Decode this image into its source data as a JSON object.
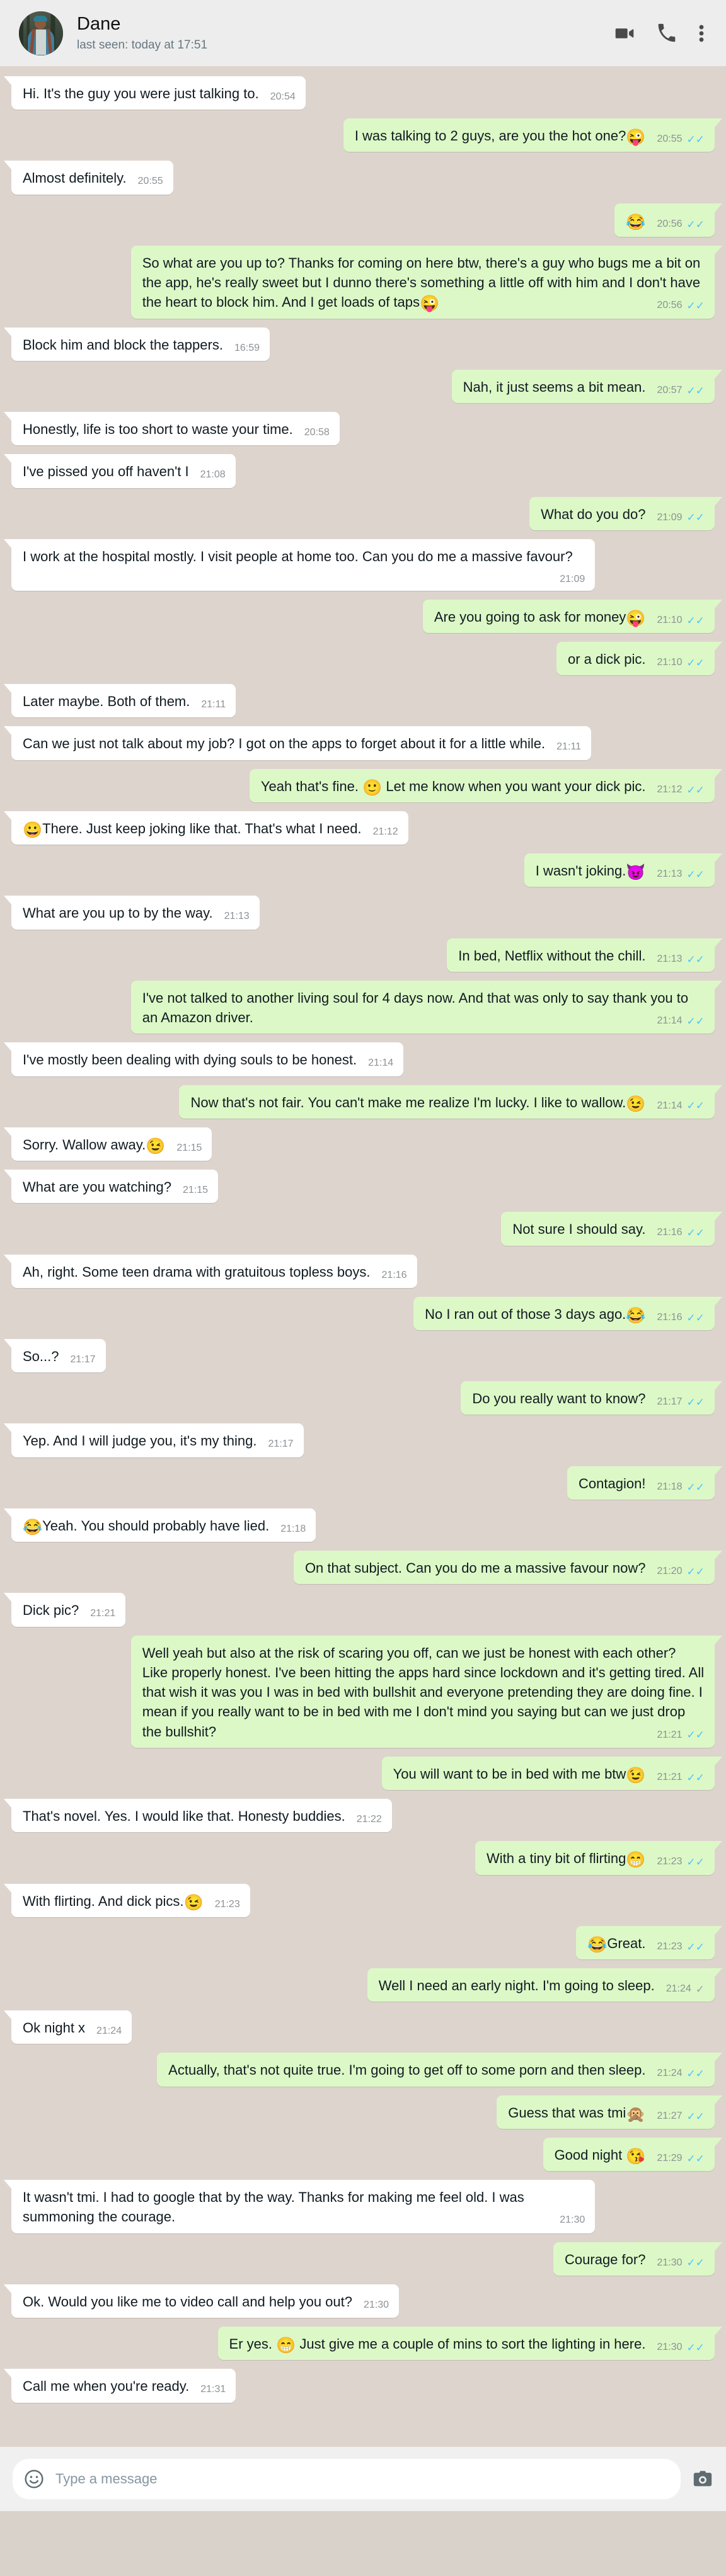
{
  "header": {
    "contact_name": "Dane",
    "status": "last seen: today at 17:51",
    "avatar_name": "contact-avatar",
    "icons": {
      "video_call": "video-camera-icon",
      "voice_call": "phone-icon",
      "menu": "overflow-menu-icon"
    }
  },
  "composer": {
    "placeholder": "Type a message",
    "value": "",
    "emoji_icon": "smiley-face-icon",
    "camera_icon": "camera-icon"
  },
  "colors": {
    "incoming_bubble": "#ffffff",
    "outgoing_bubble": "#dcf8c6",
    "chat_background": "#ded4ce",
    "header_background": "#ededed",
    "read_tick": "#4fc3f7",
    "delivered_tick": "#9aa4a8",
    "timestamp": "#8c9296"
  },
  "messages": [
    {
      "side": "in",
      "text": "Hi. It's the guy you were just talking to.",
      "time": "20:54",
      "status": "none"
    },
    {
      "side": "out",
      "text": "I was talking to 2 guys, are you the hot one?",
      "emoji_after": "😜",
      "time": "20:55",
      "status": "read"
    },
    {
      "side": "in",
      "text": "Almost definitely.",
      "time": "20:55",
      "status": "none"
    },
    {
      "side": "out",
      "text": "",
      "emoji_after": "😂",
      "time": "20:56",
      "status": "read"
    },
    {
      "side": "out",
      "text": "So what are you up to? Thanks for coming on here btw, there's a guy who bugs me a bit on the app, he's really sweet but I dunno there's something a little off with him and I don't have the heart to block him. And I get loads of taps",
      "emoji_after": "😜",
      "time": "20:56",
      "status": "read"
    },
    {
      "side": "in",
      "text": "Block him and block the tappers.",
      "time": "16:59",
      "status": "none"
    },
    {
      "side": "out",
      "text": "Nah, it just seems a bit mean.",
      "time": "20:57",
      "status": "read"
    },
    {
      "side": "in",
      "text": "Honestly, life is too short to waste your time.",
      "time": "20:58",
      "status": "none"
    },
    {
      "side": "in",
      "text": "I've pissed you off haven't I",
      "time": "21:08",
      "status": "none"
    },
    {
      "side": "out",
      "text": "What do you do?",
      "time": "21:09",
      "status": "read"
    },
    {
      "side": "in",
      "text": "I work at the hospital mostly. I visit people at home too. Can you do me a massive favour?",
      "time": "21:09",
      "status": "none"
    },
    {
      "side": "out",
      "text": "Are you going to ask for money",
      "emoji_after": "😜",
      "time": "21:10",
      "status": "read"
    },
    {
      "side": "out",
      "text": "or a dick pic.",
      "time": "21:10",
      "status": "read"
    },
    {
      "side": "in",
      "text": "Later maybe. Both of them.",
      "time": "21:11",
      "status": "none"
    },
    {
      "side": "in",
      "text": "Can we just not talk about my job? I got on the apps to forget about it for a little while.",
      "time": "21:11",
      "status": "none"
    },
    {
      "side": "out",
      "text": "Yeah that's fine. ",
      "emoji_mid": "🙂",
      "text2": " Let me know when you want your dick pic.",
      "time": "21:12",
      "status": "read"
    },
    {
      "side": "in",
      "emoji_before": "😀",
      "text": "There. Just keep joking like that. That's what I need.",
      "time": "21:12",
      "status": "none"
    },
    {
      "side": "out",
      "text": "I wasn't joking.",
      "emoji_after": "😈",
      "time": "21:13",
      "status": "read"
    },
    {
      "side": "in",
      "text": "What are you up to by the way.",
      "time": "21:13",
      "status": "none"
    },
    {
      "side": "out",
      "text": "In bed, Netflix without the chill.",
      "time": "21:13",
      "status": "read"
    },
    {
      "side": "out",
      "text": "I've not talked to another living soul for 4 days now. And that was only to say thank you to an Amazon driver.",
      "time": "21:14",
      "status": "read"
    },
    {
      "side": "in",
      "text": "I've mostly been dealing with dying souls to be honest.",
      "time": "21:14",
      "status": "none"
    },
    {
      "side": "out",
      "text": "Now that's not fair. You can't make me realize I'm lucky. I like to wallow.",
      "emoji_after": "😉",
      "time": "21:14",
      "status": "read"
    },
    {
      "side": "in",
      "text": "Sorry. Wallow away.",
      "emoji_after": "😉",
      "time": "21:15",
      "status": "none"
    },
    {
      "side": "in",
      "text": "What are you watching?",
      "time": "21:15",
      "status": "none"
    },
    {
      "side": "out",
      "text": "Not sure I should say.",
      "time": "21:16",
      "status": "read"
    },
    {
      "side": "in",
      "text": "Ah, right. Some teen drama with gratuitous topless boys.",
      "time": "21:16",
      "status": "none"
    },
    {
      "side": "out",
      "text": "No I ran out of those 3 days ago.",
      "emoji_after": "😂",
      "time": "21:16",
      "status": "read"
    },
    {
      "side": "in",
      "text": "So...?",
      "time": "21:17",
      "status": "none"
    },
    {
      "side": "out",
      "text": "Do you really want to know?",
      "time": "21:17",
      "status": "read"
    },
    {
      "side": "in",
      "text": "Yep. And I will judge you, it's my thing.",
      "time": "21:17",
      "status": "none"
    },
    {
      "side": "out",
      "text": "Contagion!",
      "time": "21:18",
      "status": "read"
    },
    {
      "side": "in",
      "emoji_before": "😂",
      "text": "Yeah. You should probably have lied.",
      "time": "21:18",
      "status": "none"
    },
    {
      "side": "out",
      "text": "On that subject. Can you do me a massive favour now?",
      "time": "21:20",
      "status": "read"
    },
    {
      "side": "in",
      "text": "Dick pic?",
      "time": "21:21",
      "status": "none"
    },
    {
      "side": "out",
      "text": "Well yeah but also at the risk of scaring you off, can we just be honest with each other? Like properly honest. I've been hitting the apps hard since lockdown and it's getting tired. All that wish it was you I was in bed with bullshit and everyone pretending they are doing fine. I mean if you really want to be in bed with me I don't mind you saying but can we just drop the bullshit?",
      "time": "21:21",
      "status": "read"
    },
    {
      "side": "out",
      "text": "You will want to be in bed with me btw",
      "emoji_after": "😉",
      "time": "21:21",
      "status": "read"
    },
    {
      "side": "in",
      "text": "That's novel. Yes. I would like that. Honesty buddies.",
      "time": "21:22",
      "status": "none"
    },
    {
      "side": "out",
      "text": "With a tiny bit of flirting",
      "emoji_after": "😁",
      "time": "21:23",
      "status": "read"
    },
    {
      "side": "in",
      "text": "With flirting. And dick pics.",
      "emoji_after": "😉",
      "time": "21:23",
      "status": "none"
    },
    {
      "side": "out",
      "emoji_before": "😂",
      "text": "Great.",
      "time": "21:23",
      "status": "read"
    },
    {
      "side": "out",
      "text": "Well I need an early night. I'm going to sleep.",
      "time": "21:24",
      "status": "delivered"
    },
    {
      "side": "in",
      "text": "Ok night x",
      "time": "21:24",
      "status": "none"
    },
    {
      "side": "out",
      "text": "Actually, that's not quite true. I'm going to get off to some porn and then sleep.",
      "time": "21:24",
      "status": "read"
    },
    {
      "side": "out",
      "text": "Guess that was tmi",
      "emoji_after": "🙊",
      "time": "21:27",
      "status": "read"
    },
    {
      "side": "out",
      "text": "Good night ",
      "emoji_after": "😘",
      "time": "21:29",
      "status": "read"
    },
    {
      "side": "in",
      "text": "It wasn't tmi. I had to google that by the way. Thanks for making me feel old. I was summoning the courage.",
      "time": "21:30",
      "status": "none"
    },
    {
      "side": "out",
      "text": "Courage for?",
      "time": "21:30",
      "status": "read"
    },
    {
      "side": "in",
      "text": "Ok. Would you like me to video call and help you out?",
      "time": "21:30",
      "status": "none"
    },
    {
      "side": "out",
      "text": "Er yes. ",
      "emoji_mid": "😁",
      "text2": " Just give me a couple of mins to sort the lighting in here.",
      "time": "21:30",
      "status": "read"
    },
    {
      "side": "in",
      "text": "Call me when you're ready.",
      "time": "21:31",
      "status": "none"
    }
  ]
}
